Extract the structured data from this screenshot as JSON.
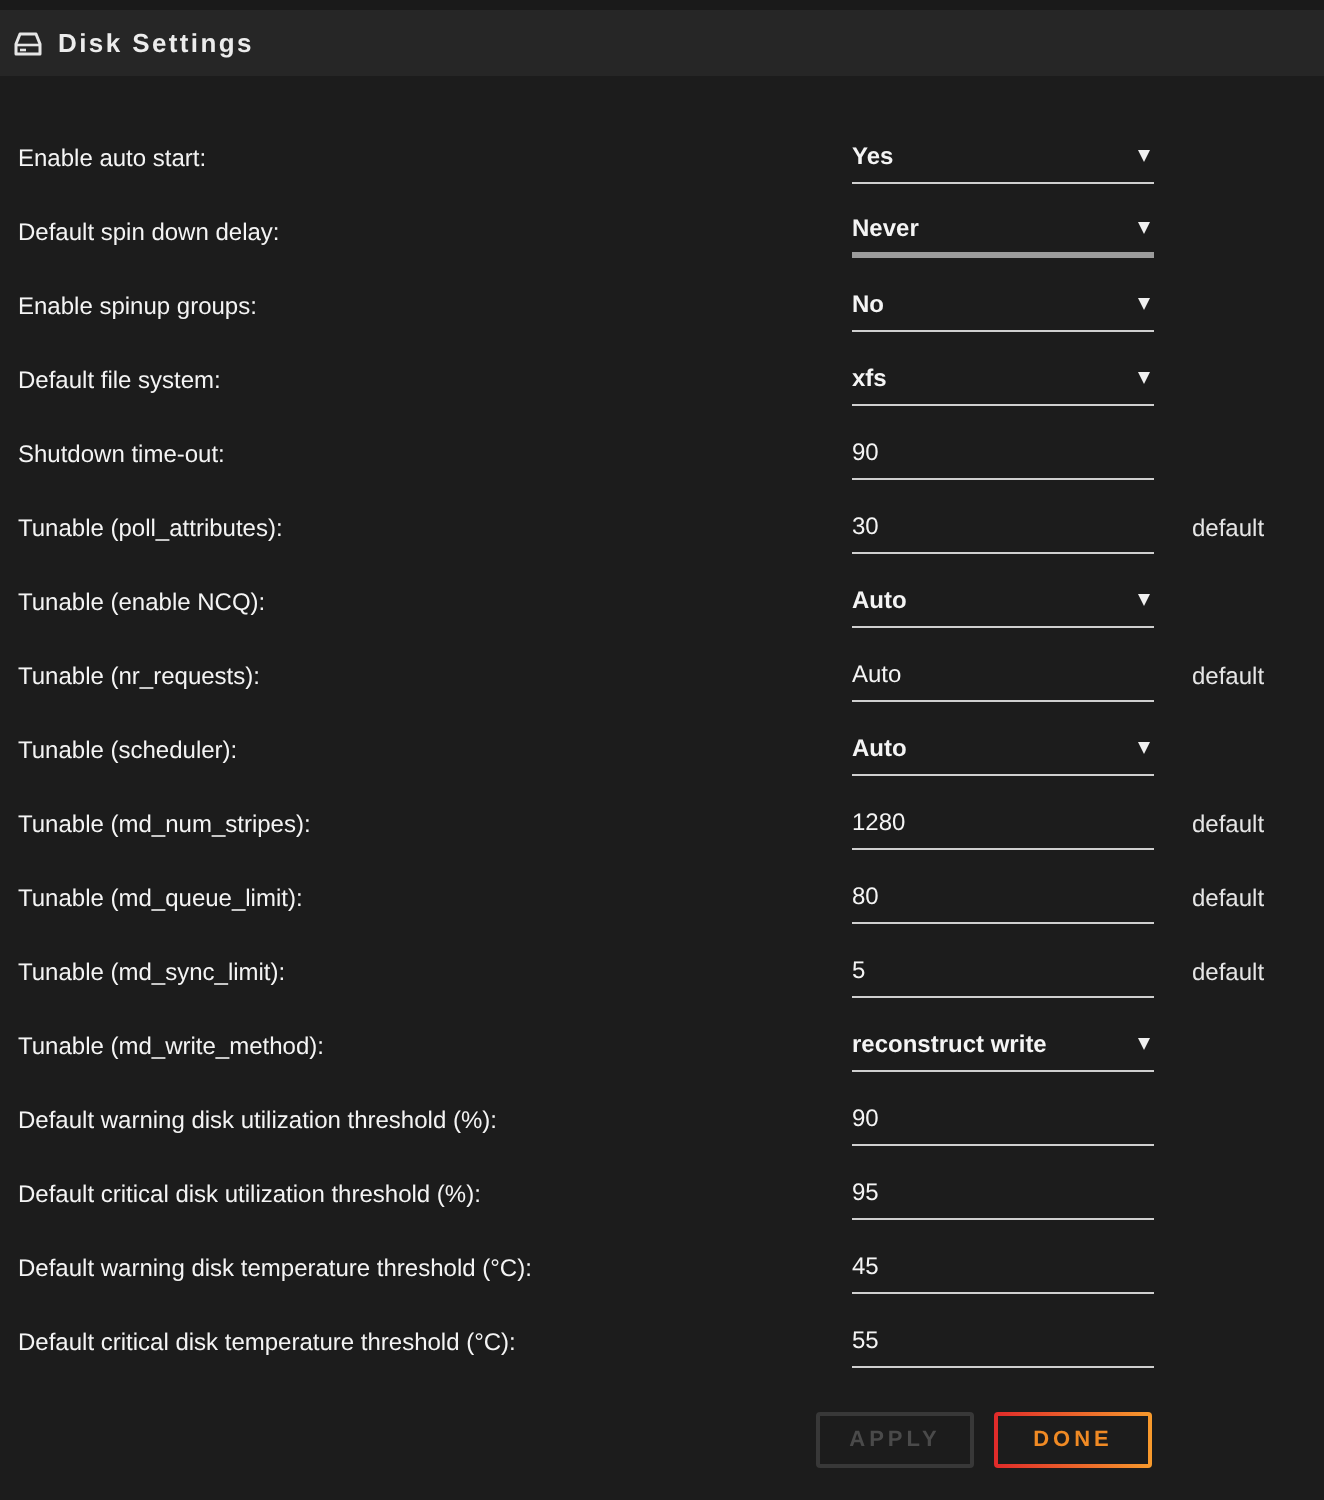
{
  "header": {
    "title": "Disk Settings"
  },
  "settings": [
    {
      "label": "Enable auto start:",
      "kind": "select",
      "value": "Yes",
      "focused": false
    },
    {
      "label": "Default spin down delay:",
      "kind": "select",
      "value": "Never",
      "focused": true
    },
    {
      "label": "Enable spinup groups:",
      "kind": "select",
      "value": "No",
      "focused": false
    },
    {
      "label": "Default file system:",
      "kind": "select",
      "value": "xfs",
      "focused": false
    },
    {
      "label": "Shutdown time-out:",
      "kind": "text",
      "value": "90",
      "focused": false
    },
    {
      "label": "Tunable (poll_attributes):",
      "kind": "text",
      "value": "30",
      "focused": false,
      "note": "default"
    },
    {
      "label": "Tunable (enable NCQ):",
      "kind": "select",
      "value": "Auto",
      "focused": false
    },
    {
      "label": "Tunable (nr_requests):",
      "kind": "text",
      "value": "Auto",
      "focused": false,
      "note": "default"
    },
    {
      "label": "Tunable (scheduler):",
      "kind": "select",
      "value": "Auto",
      "focused": false
    },
    {
      "label": "Tunable (md_num_stripes):",
      "kind": "text",
      "value": "1280",
      "focused": false,
      "note": "default"
    },
    {
      "label": "Tunable (md_queue_limit):",
      "kind": "text",
      "value": "80",
      "focused": false,
      "note": "default"
    },
    {
      "label": "Tunable (md_sync_limit):",
      "kind": "text",
      "value": "5",
      "focused": false,
      "note": "default"
    },
    {
      "label": "Tunable (md_write_method):",
      "kind": "select",
      "value": "reconstruct write",
      "focused": false
    },
    {
      "label": "Default warning disk utilization threshold (%):",
      "kind": "text",
      "value": "90",
      "focused": false
    },
    {
      "label": "Default critical disk utilization threshold (%):",
      "kind": "text",
      "value": "95",
      "focused": false
    },
    {
      "label": "Default warning disk temperature threshold (°C):",
      "kind": "text",
      "value": "45",
      "focused": false
    },
    {
      "label": "Default critical disk temperature threshold (°C):",
      "kind": "text",
      "value": "55",
      "focused": false
    }
  ],
  "buttons": [
    {
      "label": "APPLY",
      "disabled": true
    },
    {
      "label": "DONE",
      "disabled": false
    }
  ]
}
